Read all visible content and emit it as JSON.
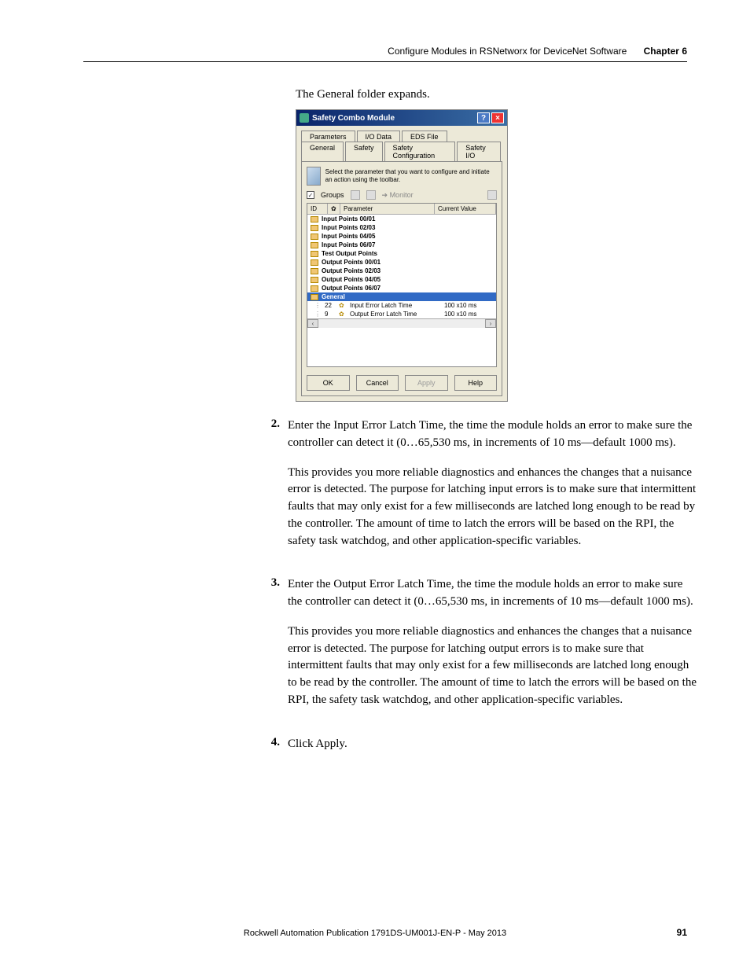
{
  "header": {
    "section": "Configure Modules in RSNetworx for DeviceNet Software",
    "chapter": "Chapter 6"
  },
  "intro": "The General folder expands.",
  "dialog": {
    "title": "Safety Combo Module",
    "help_glyph": "?",
    "close_glyph": "×",
    "tabs_row1": {
      "t1": "Parameters",
      "t2": "I/O Data",
      "t3": "EDS File"
    },
    "tabs_row2": {
      "t1": "General",
      "t2": "Safety",
      "t3": "Safety Configuration",
      "t4": "Safety I/O"
    },
    "hint": "Select the parameter that you want to configure and initiate an action using the toolbar.",
    "groups_chk": "✓",
    "groups_label": "Groups",
    "monitor_label": "Monitor",
    "columns": {
      "id": "ID",
      "param": "Parameter",
      "val": "Current Value"
    },
    "folders": {
      "f0": "Input Points 00/01",
      "f1": "Input Points 02/03",
      "f2": "Input Points 04/05",
      "f3": "Input Points 06/07",
      "f4": "Test Output Points",
      "f5": "Output Points 00/01",
      "f6": "Output Points 02/03",
      "f7": "Output Points 04/05",
      "f8": "Output Points 06/07",
      "general": "General"
    },
    "params": {
      "p0": {
        "tree": "⋮",
        "id": "22",
        "lock": "✿",
        "name": "Input Error Latch Time",
        "val": "100 x10 ms"
      },
      "p1": {
        "tree": "⋮",
        "id": "9",
        "lock": "✿",
        "name": "Output Error Latch Time",
        "val": "100 x10 ms"
      }
    },
    "scroll_left": "‹",
    "scroll_right": "›",
    "buttons": {
      "ok": "OK",
      "cancel": "Cancel",
      "apply": "Apply",
      "help": "Help"
    }
  },
  "steps": {
    "s2": {
      "num": "2.",
      "p1": "Enter the Input Error Latch Time, the time the module holds an error to make sure the controller can detect it (0…65,530 ms, in increments of 10 ms—default 1000 ms).",
      "p2": "This provides you more reliable diagnostics and enhances the changes that a nuisance error is detected. The purpose for latching input errors is to make sure that intermittent faults that may only exist for a few milliseconds are latched long enough to be read by the controller. The amount of time to latch the errors will be based on the RPI, the safety task watchdog, and other application-specific variables."
    },
    "s3": {
      "num": "3.",
      "p1": "Enter the Output Error Latch Time, the time the module holds an error to make sure the controller can detect it (0…65,530 ms, in increments of 10 ms—default 1000 ms).",
      "p2": "This provides you more reliable diagnostics and enhances the changes that a nuisance error is detected. The purpose for latching output errors is to make sure that intermittent faults that may only exist for a few milliseconds are latched long enough to be read by the controller. The amount of time to latch the errors will be based on the RPI, the safety task watchdog, and other application-specific variables."
    },
    "s4": {
      "num": "4.",
      "p1": "Click Apply."
    }
  },
  "footer": "Rockwell Automation Publication 1791DS-UM001J-EN-P - May 2013",
  "page_num": "91"
}
